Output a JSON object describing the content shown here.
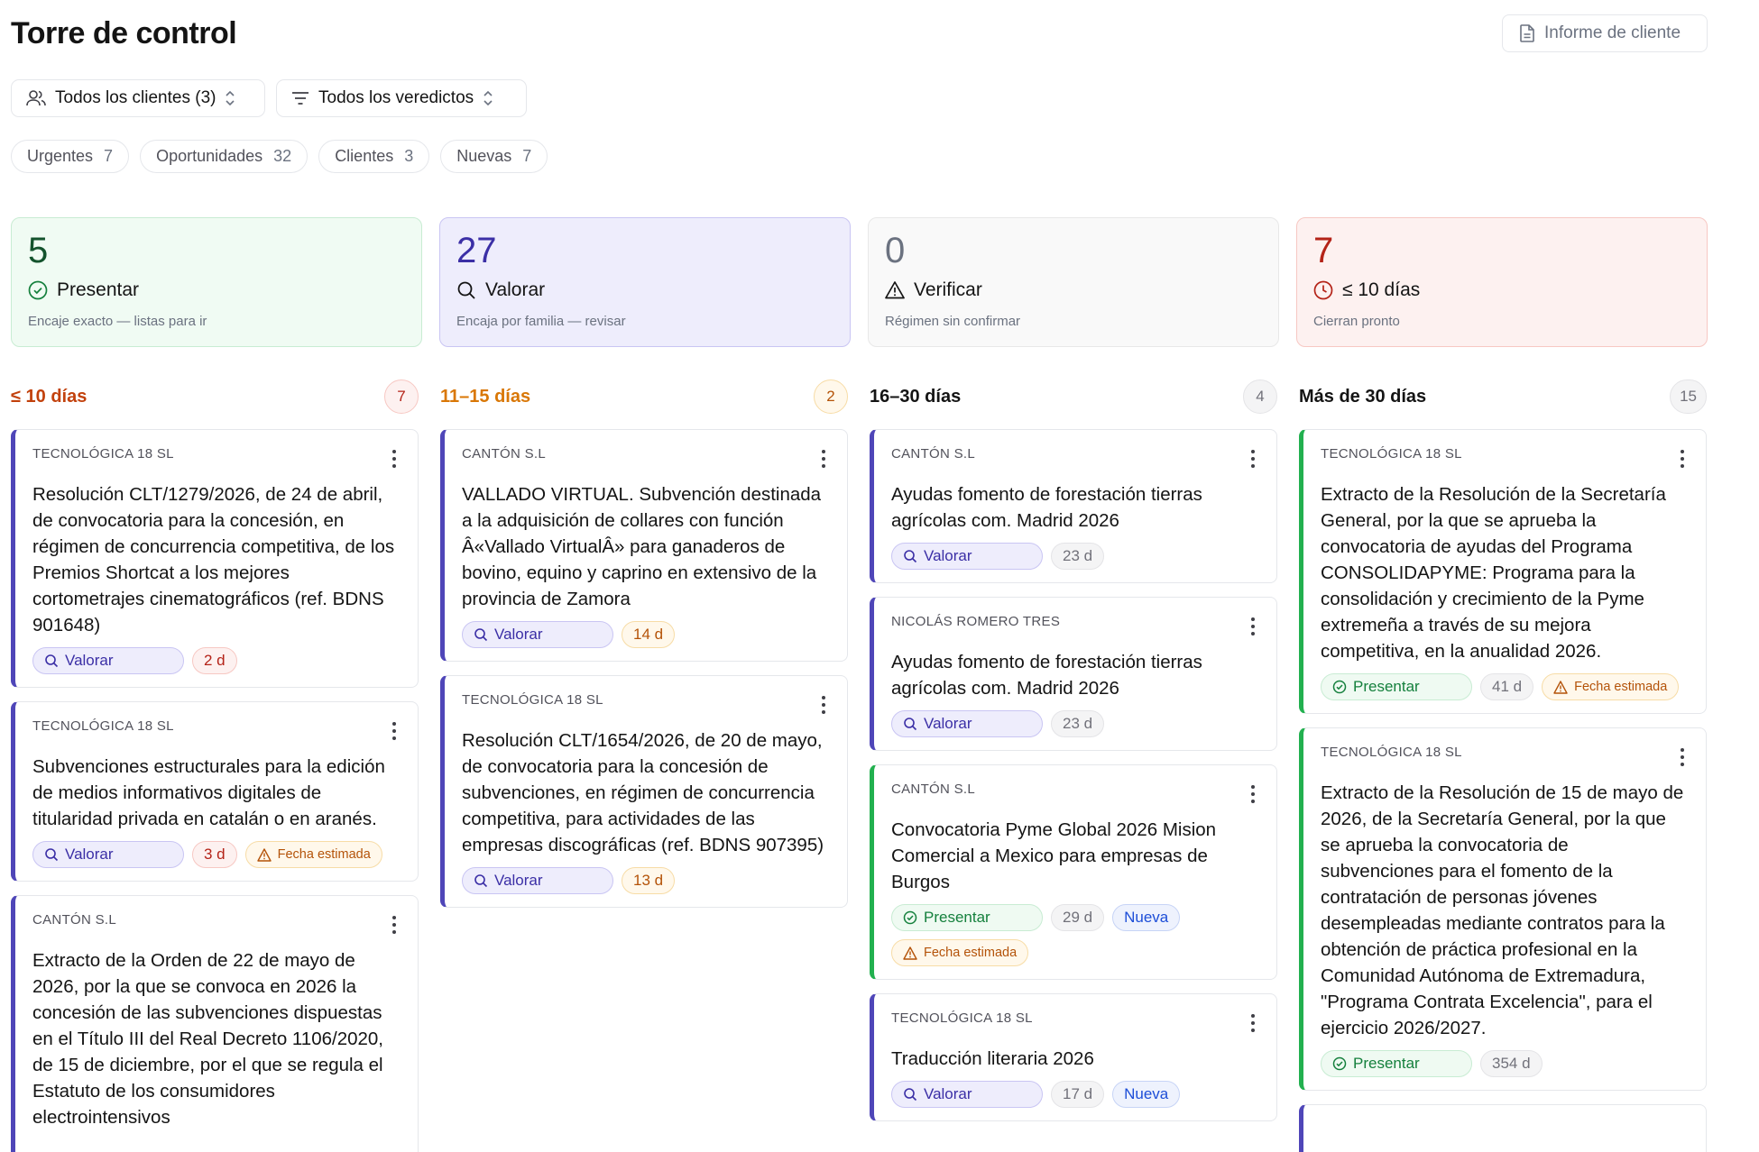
{
  "header": {
    "title": "Torre de control",
    "report_button": "Informe de cliente"
  },
  "filters": {
    "clients": "Todos los clientes (3)",
    "verdicts": "Todos los veredictos"
  },
  "chips": [
    {
      "label": "Urgentes",
      "count": "7"
    },
    {
      "label": "Oportunidades",
      "count": "32"
    },
    {
      "label": "Clientes",
      "count": "3"
    },
    {
      "label": "Nuevas",
      "count": "7"
    }
  ],
  "stats": [
    {
      "number": "5",
      "label": "Presentar",
      "sub": "Encaje exacto — listas para ir"
    },
    {
      "number": "27",
      "label": "Valorar",
      "sub": "Encaja por familia — revisar"
    },
    {
      "number": "0",
      "label": "Verificar",
      "sub": "Régimen sin confirmar"
    },
    {
      "number": "7",
      "label": "≤ 10 días",
      "sub": "Cierran pronto"
    }
  ],
  "columns": [
    {
      "title": "≤ 10 días",
      "count": "7",
      "cards": [
        {
          "client": "TECNOLÓGICA 18 SL",
          "title": "Resolución CLT/1279/2026, de 24 de abril, de convocatoria para la concesión, en régimen de concurrencia competitiva, de los Premios Shortcat a los mejores cortometrajes cinematográficos (ref. BDNS 901648)",
          "verdict": "Valorar",
          "days": "2 d"
        },
        {
          "client": "TECNOLÓGICA 18 SL",
          "title": "Subvenciones estructurales para la edición de medios informativos digitales de titularidad privada en catalán o en aranés.",
          "verdict": "Valorar",
          "days": "3 d",
          "estimated": "Fecha estimada"
        },
        {
          "client": "CANTÓN S.L",
          "title": "Extracto de la Orden de 22 de mayo de 2026, por la que se convoca en 2026 la concesión de las subvenciones dispuestas en el Título III del Real Decreto 1106/2020, de 15 de diciembre, por el que se regula el Estatuto de los consumidores electrointensivos"
        }
      ]
    },
    {
      "title": "11–15 días",
      "count": "2",
      "cards": [
        {
          "client": "CANTÓN S.L",
          "title": "VALLADO VIRTUAL. Subvención destinada a la adquisición de collares con función Â«Vallado VirtualÂ» para ganaderos de bovino, equino y caprino en extensivo de la provincia de Zamora",
          "verdict": "Valorar",
          "days": "14 d"
        },
        {
          "client": "TECNOLÓGICA 18 SL",
          "title": "Resolución CLT/1654/2026, de 20 de mayo, de convocatoria para la concesión de subvenciones, en régimen de concurrencia competitiva, para actividades de las empresas discográficas (ref. BDNS 907395)",
          "verdict": "Valorar",
          "days": "13 d"
        }
      ]
    },
    {
      "title": "16–30 días",
      "count": "4",
      "cards": [
        {
          "client": "CANTÓN S.L",
          "title": "Ayudas fomento de forestación tierras agrícolas com. Madrid 2026",
          "verdict": "Valorar",
          "days": "23 d"
        },
        {
          "client": "NICOLÁS ROMERO TRES",
          "title": "Ayudas fomento de forestación tierras agrícolas com. Madrid 2026",
          "verdict": "Valorar",
          "days": "23 d"
        },
        {
          "client": "CANTÓN S.L",
          "title": "Convocatoria Pyme Global 2026 Mision Comercial a Mexico para empresas de Burgos",
          "verdict": "Presentar",
          "days": "29 d",
          "nueva": "Nueva",
          "estimated": "Fecha estimada"
        },
        {
          "client": "TECNOLÓGICA 18 SL",
          "title": "Traducción literaria 2026",
          "verdict": "Valorar",
          "days": "17 d",
          "nueva": "Nueva"
        }
      ]
    },
    {
      "title": "Más de 30 días",
      "count": "15",
      "cards": [
        {
          "client": "TECNOLÓGICA 18 SL",
          "title": "Extracto de la Resolución de la Secretaría General, por la que se aprueba la convocatoria de ayudas del Programa CONSOLIDAPYME: Programa para la consolidación y crecimiento de la Pyme extremeña a través de su mejora competitiva, en la anualidad 2026.",
          "verdict": "Presentar",
          "days": "41 d",
          "estimated": "Fecha estimada"
        },
        {
          "client": "TECNOLÓGICA 18 SL",
          "title": "Extracto de la Resolución de 15 de mayo de 2026, de la Secretaría General, por la que se aprueba la convocatoria de subvenciones para el fomento de la contratación de personas jóvenes desempleadas mediante contratos para la obtención de práctica profesional en la Comunidad Autónoma de Extremadura, \"Programa Contrata Excelencia\", para el ejercicio 2026/2027.",
          "verdict": "Presentar",
          "days": "354 d"
        },
        {
          "client": "",
          "title": ""
        }
      ]
    }
  ],
  "colors": {
    "urgent": "#c2410c",
    "soon": "#d97706",
    "valorar": "#4f46b8",
    "presentar": "#22b04f"
  }
}
